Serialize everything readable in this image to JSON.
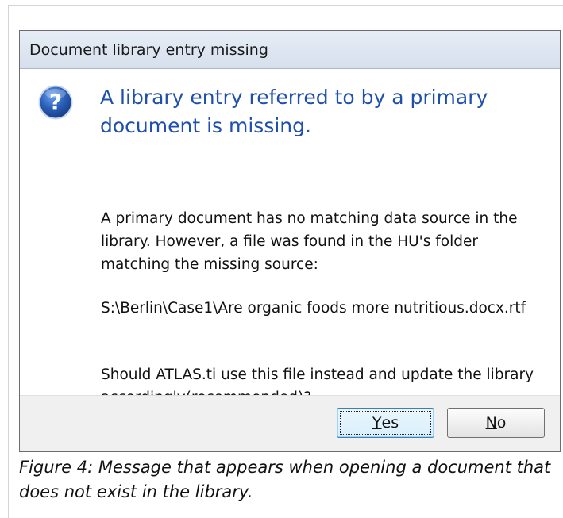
{
  "dialog": {
    "title": "Document library entry missing",
    "icon": "question-icon",
    "main_instruction": "A library entry referred to by a primary document is missing.",
    "paragraphs": [
      "A primary document has no matching data source in the library. However, a file was found in the HU's folder matching the missing source:",
      "S:\\Berlin\\Case1\\Are organic foods more nutritious.docx.rtf",
      "Should ATLAS.ti use this file instead and update the library accordingly(recommended)?"
    ],
    "buttons": {
      "yes": {
        "mnemonic": "Y",
        "rest": "es"
      },
      "no": {
        "mnemonic": "N",
        "rest": "o"
      }
    },
    "colors": {
      "instruction_text": "#1f4fad",
      "icon_blue": "#2a5fb8",
      "titlebar": "#dce5f0",
      "footer": "#f0f0f0"
    }
  },
  "caption": "Figure 4: Message that appears when opening a document that does not exist in the library."
}
